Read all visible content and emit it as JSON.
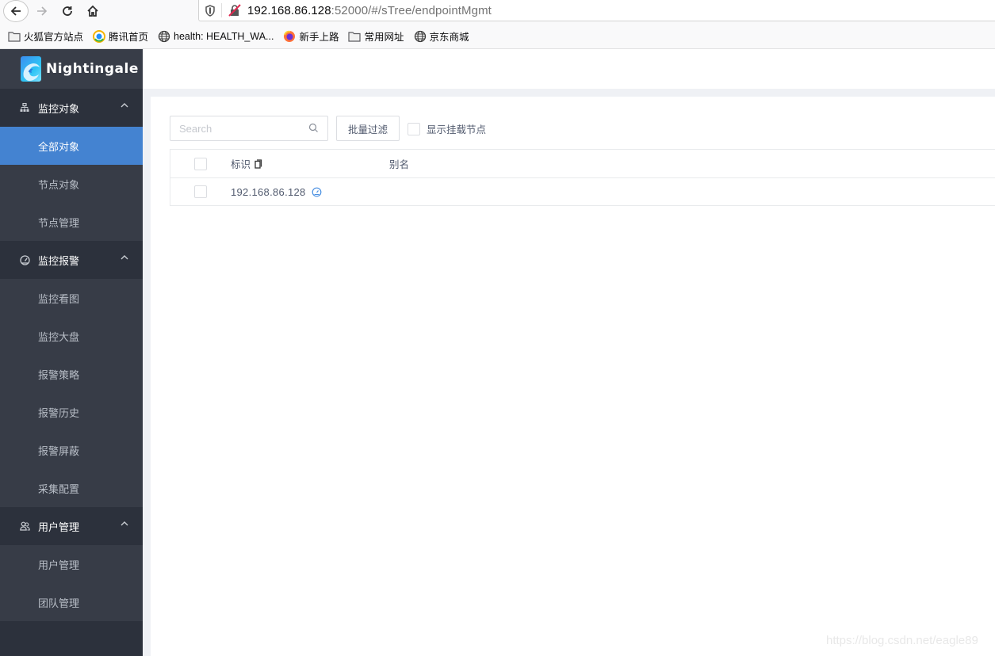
{
  "browser": {
    "url_host": "192.168.86.128",
    "url_rest": ":52000/#/sTree/endpointMgmt",
    "bookmarks": [
      {
        "label": "火狐官方站点",
        "icon": "folder-icon"
      },
      {
        "label": "腾讯首页",
        "icon": "tencent-icon"
      },
      {
        "label": "health: HEALTH_WA...",
        "icon": "globe-icon"
      },
      {
        "label": "新手上路",
        "icon": "firefox-icon"
      },
      {
        "label": "常用网址",
        "icon": "folder-icon"
      },
      {
        "label": "京东商城",
        "icon": "globe-icon"
      }
    ]
  },
  "sidebar": {
    "brand": "Nightingale",
    "groups": [
      {
        "label": "监控对象",
        "icon": "sitemap-icon",
        "items": [
          {
            "label": "全部对象",
            "active": true
          },
          {
            "label": "节点对象",
            "active": false
          },
          {
            "label": "节点管理",
            "active": false
          }
        ]
      },
      {
        "label": "监控报警",
        "icon": "dashboard-icon",
        "items": [
          {
            "label": "监控看图"
          },
          {
            "label": "监控大盘"
          },
          {
            "label": "报警策略"
          },
          {
            "label": "报警历史"
          },
          {
            "label": "报警屏蔽"
          },
          {
            "label": "采集配置"
          }
        ]
      },
      {
        "label": "用户管理",
        "icon": "users-icon",
        "items": [
          {
            "label": "用户管理"
          },
          {
            "label": "团队管理"
          }
        ]
      }
    ]
  },
  "toolbar": {
    "search_placeholder": "Search",
    "search_value": "",
    "filter_button": "批量过滤",
    "show_mounted_label": "显示挂载节点",
    "show_mounted_checked": false
  },
  "table": {
    "columns": [
      "标识",
      "别名"
    ],
    "rows": [
      {
        "ident": "192.168.86.128",
        "alias": ""
      }
    ]
  },
  "watermark": "https://blog.csdn.net/eagle89",
  "colors": {
    "sidebar_bg": "#2c313c",
    "sidebar_sub_bg": "#373c47",
    "active": "#4483d1"
  }
}
